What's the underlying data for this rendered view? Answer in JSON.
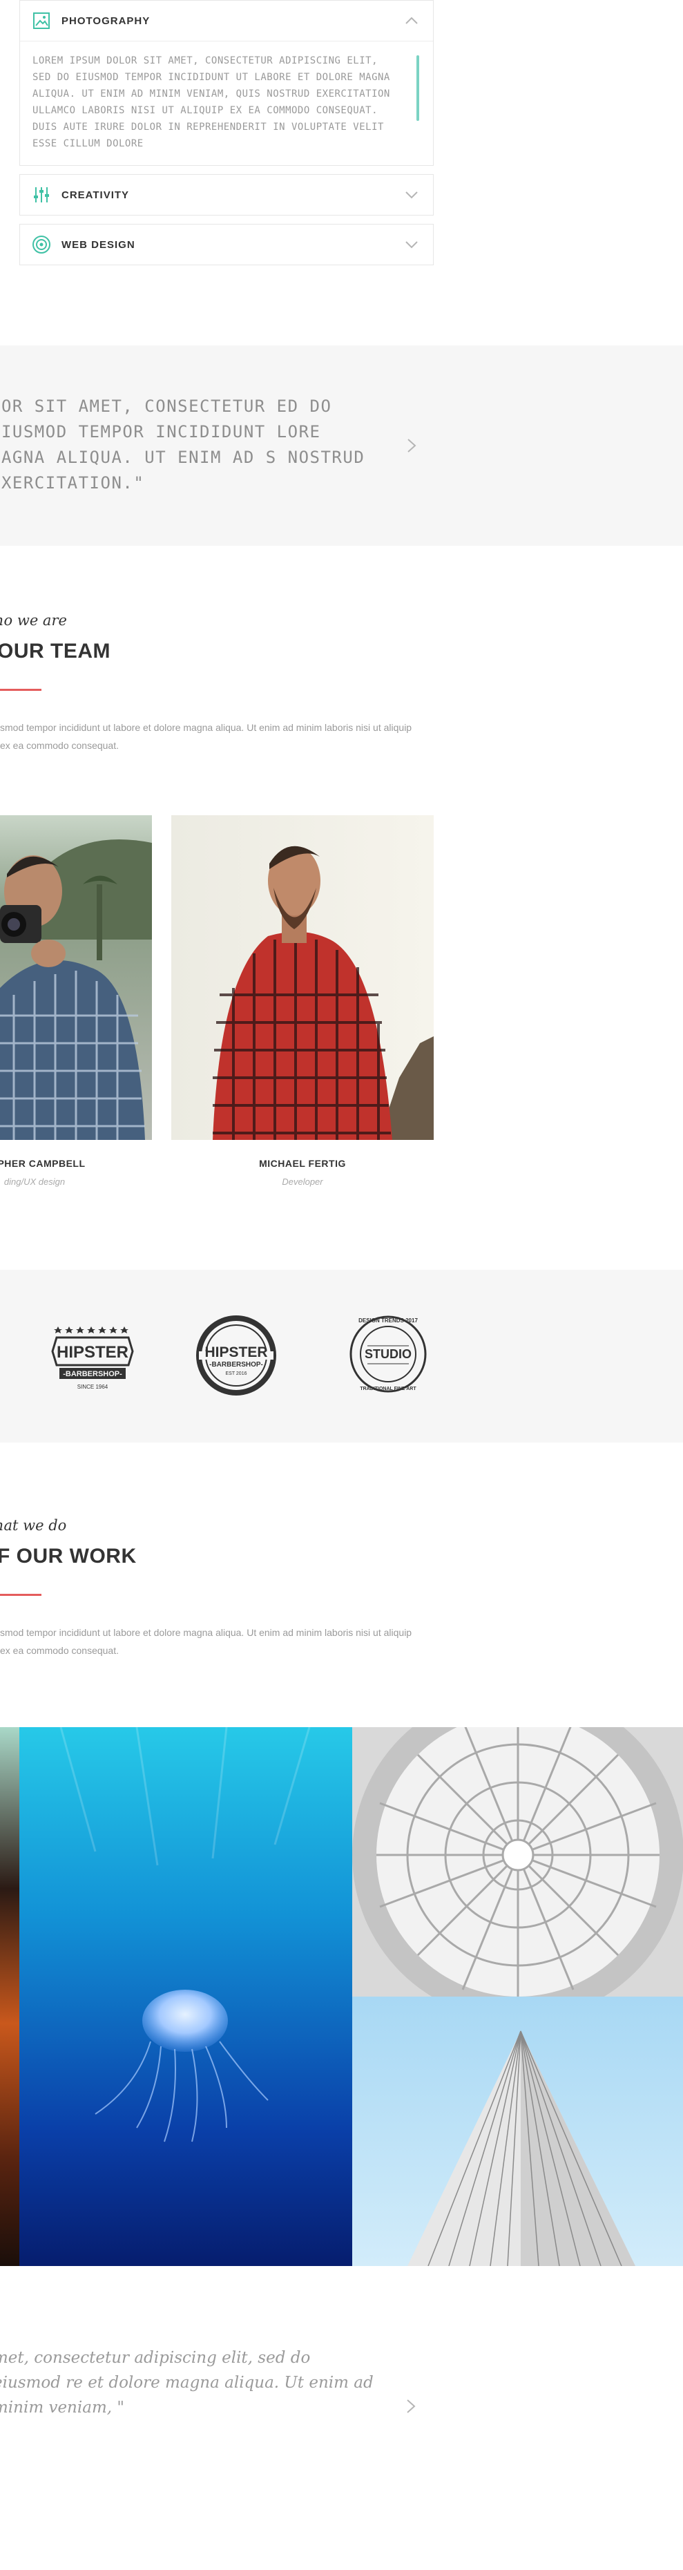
{
  "accordion": {
    "items": [
      {
        "title": "PHOTOGRAPHY",
        "icon": "image-icon",
        "expanded": true,
        "body": "LOREM IPSUM DOLOR SIT AMET, CONSECTETUR ADIPISCING ELIT, SED DO EIUSMOD TEMPOR INCIDIDUNT UT LABORE ET DOLORE MAGNA ALIQUA. UT ENIM AD MINIM VENIAM, QUIS NOSTRUD EXERCITATION ULLAMCO LABORIS NISI UT ALIQUIP EX EA COMMODO CONSEQUAT. DUIS AUTE IRURE DOLOR IN REPREHENDERIT IN VOLUPTATE VELIT ESSE CILLUM DOLORE"
      },
      {
        "title": "CREATIVITY",
        "icon": "sliders-icon",
        "expanded": false
      },
      {
        "title": "WEB DESIGN",
        "icon": "target-icon",
        "expanded": false
      }
    ],
    "accent_color": "#3fc1a5"
  },
  "quote1": {
    "text": "LOR SIT AMET, CONSECTETUR ED DO EIUSMOD TEMPOR INCIDIDUNT LORE MAGNA ALIQUA. UT ENIM AD S NOSTRUD EXERCITATION.\""
  },
  "team": {
    "subtitle": "ho we are",
    "title": "OUR TEAM",
    "description": "smod tempor incididunt ut labore et dolore magna aliqua. Ut enim ad minim laboris nisi ut aliquip ex ea commodo consequat.",
    "members": [
      {
        "name": "PHER CAMPBELL",
        "role": "ding/UX design"
      },
      {
        "name": "MICHAEL FERTIG",
        "role": "Developer"
      }
    ]
  },
  "clients": {
    "logos": [
      {
        "name": "hipster-barbershop-badge-logo",
        "line1": "HIPSTER",
        "line2": "-BARBERSHOP-",
        "line3": "SINCE 1964"
      },
      {
        "name": "hipster-barbershop-circle-logo",
        "line1": "HIPSTER",
        "line2": "-BARBERSHOP-",
        "line3": "EST 2016"
      },
      {
        "name": "studio-round-logo",
        "line1": "DESIGN TRENDS 2017",
        "line2": "STUDIO",
        "line3": "TRADITIONAL FINE ART"
      }
    ]
  },
  "work": {
    "subtitle": "hat we do",
    "title": "F OUR WORK",
    "description": "smod tempor incididunt ut labore et dolore magna aliqua. Ut enim ad minim laboris nisi ut aliquip ex ea commodo consequat."
  },
  "quote2": {
    "text": "met, consectetur adipiscing elit, sed do eiusmod re et dolore magna aliqua. Ut enim ad minim veniam, \""
  },
  "colors": {
    "accent_red": "#e45c5c",
    "accent_teal": "#3fc1a5",
    "section_bg": "#f6f6f6"
  }
}
